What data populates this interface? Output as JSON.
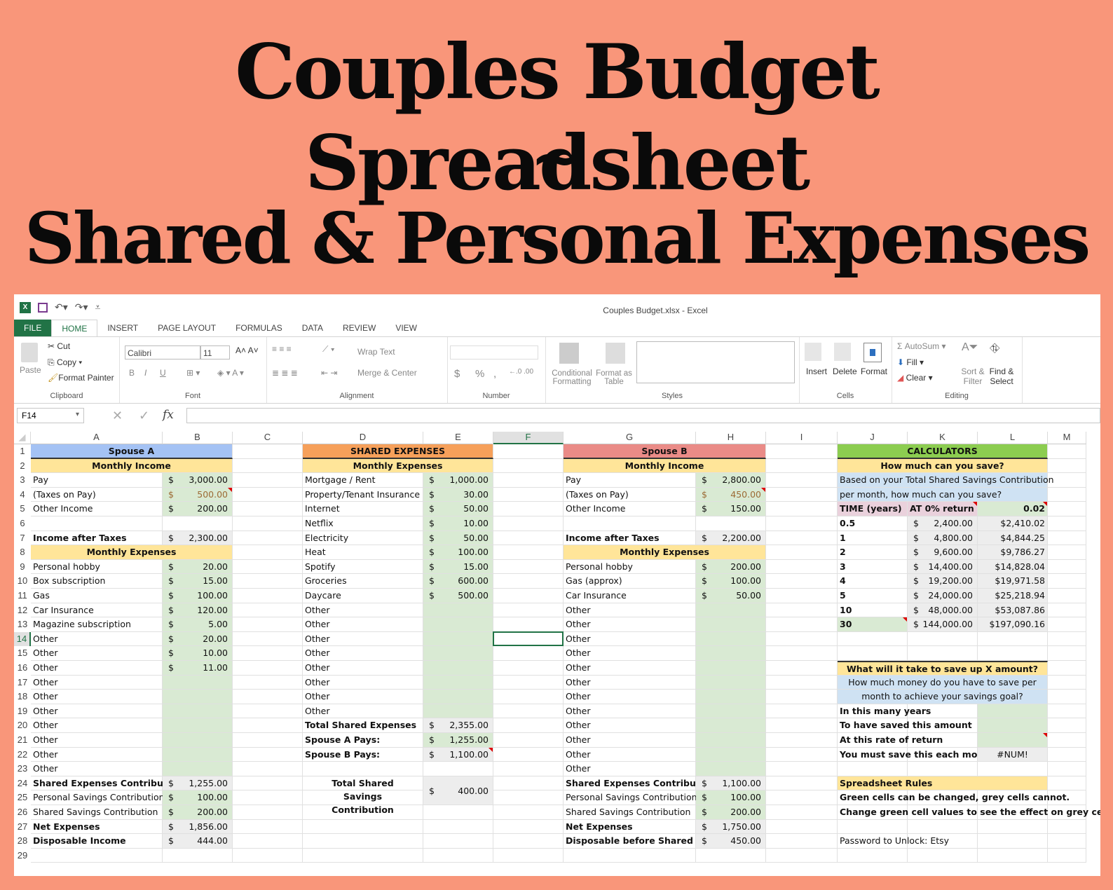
{
  "banner": {
    "line1": "Couples Budget Spreadsheet",
    "line2": "~",
    "line3": "Shared & Personal Expenses"
  },
  "window": {
    "title": "Couples Budget.xlsx - Excel"
  },
  "tabs": [
    "FILE",
    "HOME",
    "INSERT",
    "PAGE LAYOUT",
    "FORMULAS",
    "DATA",
    "REVIEW",
    "VIEW"
  ],
  "ribbon": {
    "clipboard": {
      "paste": "Paste",
      "cut": "Cut",
      "copy": "Copy",
      "format_painter": "Format Painter",
      "label": "Clipboard"
    },
    "font": {
      "name": "Calibri",
      "size": "11",
      "label": "Font",
      "bold": "B",
      "italic": "I",
      "underline": "U"
    },
    "alignment": {
      "wrap": "Wrap Text",
      "merge": "Merge & Center",
      "label": "Alignment"
    },
    "number": {
      "currency": "$",
      "percent": "%",
      "comma": ",",
      "label": "Number"
    },
    "styles": {
      "conditional": "Conditional Formatting",
      "format_table": "Format as Table",
      "label": "Styles"
    },
    "cells": {
      "insert": "Insert",
      "delete": "Delete",
      "format": "Format",
      "label": "Cells"
    },
    "editing": {
      "autosum": "AutoSum",
      "fill": "Fill",
      "clear": "Clear",
      "sort": "Sort & Filter",
      "find": "Find & Select",
      "label": "Editing"
    }
  },
  "formula_bar": {
    "name_box": "F14",
    "fx": "fx",
    "value": ""
  },
  "columns": [
    "A",
    "B",
    "C",
    "D",
    "E",
    "F",
    "G",
    "H",
    "I",
    "J",
    "K",
    "L",
    "M"
  ],
  "selected_cell": "F14",
  "spouseA": {
    "title": "Spouse A",
    "income_header": "Monthly Income",
    "income": [
      {
        "label": "Pay",
        "value": "3,000.00"
      },
      {
        "label": "(Taxes on Pay)",
        "value": "500.00"
      },
      {
        "label": "Other Income",
        "value": "200.00"
      }
    ],
    "after_tax": {
      "label": "Income after Taxes",
      "value": "2,300.00"
    },
    "expense_header": "Monthly Expenses",
    "expenses": [
      {
        "label": "Personal hobby",
        "value": "20.00"
      },
      {
        "label": "Box subscription",
        "value": "15.00"
      },
      {
        "label": "Gas",
        "value": "100.00"
      },
      {
        "label": "Car Insurance",
        "value": "120.00"
      },
      {
        "label": "Magazine subscription",
        "value": "5.00"
      },
      {
        "label": "Other",
        "value": "20.00"
      },
      {
        "label": "Other",
        "value": "10.00"
      },
      {
        "label": "Other",
        "value": "11.00"
      },
      {
        "label": "Other",
        "value": ""
      },
      {
        "label": "Other",
        "value": ""
      },
      {
        "label": "Other",
        "value": ""
      },
      {
        "label": "Other",
        "value": ""
      },
      {
        "label": "Other",
        "value": ""
      },
      {
        "label": "Other",
        "value": ""
      },
      {
        "label": "Other",
        "value": ""
      }
    ],
    "summary": [
      {
        "label": "Shared Expenses Contribution",
        "value": "1,255.00",
        "bold": true,
        "fill": "grey"
      },
      {
        "label": "Personal Savings Contribution",
        "value": "100.00",
        "bold": false,
        "fill": "green"
      },
      {
        "label": "Shared Savings Contribution",
        "value": "200.00",
        "bold": false,
        "fill": "green"
      },
      {
        "label": "Net Expenses",
        "value": "1,856.00",
        "bold": true,
        "fill": "grey"
      },
      {
        "label": "Disposable Income",
        "value": "444.00",
        "bold": true,
        "fill": "grey"
      }
    ]
  },
  "shared": {
    "title": "SHARED EXPENSES",
    "expense_header": "Monthly Expenses",
    "expenses": [
      {
        "label": "Mortgage / Rent",
        "value": "1,000.00"
      },
      {
        "label": "Property/Tenant Insurance",
        "value": "30.00"
      },
      {
        "label": "Internet",
        "value": "50.00"
      },
      {
        "label": "Netflix",
        "value": "10.00"
      },
      {
        "label": "Electricity",
        "value": "50.00"
      },
      {
        "label": "Heat",
        "value": "100.00"
      },
      {
        "label": "Spotify",
        "value": "15.00"
      },
      {
        "label": "Groceries",
        "value": "600.00"
      },
      {
        "label": "Daycare",
        "value": "500.00"
      },
      {
        "label": "Other",
        "value": ""
      },
      {
        "label": "Other",
        "value": ""
      },
      {
        "label": "Other",
        "value": ""
      },
      {
        "label": "Other",
        "value": ""
      },
      {
        "label": "Other",
        "value": ""
      },
      {
        "label": "Other",
        "value": ""
      },
      {
        "label": "Other",
        "value": ""
      },
      {
        "label": "Other",
        "value": ""
      }
    ],
    "totals": [
      {
        "label": "Total Shared Expenses",
        "value": "2,355.00",
        "fill": "grey"
      },
      {
        "label": "Spouse A Pays:",
        "value": "1,255.00",
        "fill": "green"
      },
      {
        "label": "Spouse B Pays:",
        "value": "1,100.00",
        "fill": "grey"
      }
    ],
    "savings": {
      "label": "Total Shared Savings Contribution",
      "value": "400.00"
    }
  },
  "spouseB": {
    "title": "Spouse B",
    "income_header": "Monthly Income",
    "income": [
      {
        "label": "Pay",
        "value": "2,800.00"
      },
      {
        "label": "(Taxes on Pay)",
        "value": "450.00"
      },
      {
        "label": "Other Income",
        "value": "150.00"
      }
    ],
    "after_tax": {
      "label": "Income after Taxes",
      "value": "2,200.00"
    },
    "expense_header": "Monthly Expenses",
    "expenses": [
      {
        "label": "Personal hobby",
        "value": "200.00"
      },
      {
        "label": "Gas (approx)",
        "value": "100.00"
      },
      {
        "label": "Car Insurance",
        "value": "50.00"
      },
      {
        "label": "Other",
        "value": ""
      },
      {
        "label": "Other",
        "value": ""
      },
      {
        "label": "Other",
        "value": ""
      },
      {
        "label": "Other",
        "value": ""
      },
      {
        "label": "Other",
        "value": ""
      },
      {
        "label": "Other",
        "value": ""
      },
      {
        "label": "Other",
        "value": ""
      },
      {
        "label": "Other",
        "value": ""
      },
      {
        "label": "Other",
        "value": ""
      },
      {
        "label": "Other",
        "value": ""
      },
      {
        "label": "Other",
        "value": ""
      },
      {
        "label": "Other",
        "value": ""
      }
    ],
    "summary": [
      {
        "label": "Shared Expenses Contribution",
        "value": "1,100.00",
        "bold": true,
        "fill": "grey"
      },
      {
        "label": "Personal Savings Contribution",
        "value": "100.00",
        "bold": false,
        "fill": "green"
      },
      {
        "label": "Shared Savings Contribution",
        "value": "200.00",
        "bold": false,
        "fill": "green"
      },
      {
        "label": "Net Expenses",
        "value": "1,750.00",
        "bold": true,
        "fill": "grey"
      },
      {
        "label": "Disposable before Shared",
        "value": "450.00",
        "bold": true,
        "fill": "grey"
      }
    ]
  },
  "calculators": {
    "title": "CALCULATORS",
    "save_header": "How much can you save?",
    "save_desc": [
      "Based on your Total Shared Savings Contribution",
      "per month, how much can you save?"
    ],
    "col_time": "TIME (years)",
    "col_zero": "AT 0% return",
    "rate": "0.02",
    "rows": [
      {
        "years": "0.5",
        "zero": "2,400.00",
        "rate": "$2,410.02"
      },
      {
        "years": "1",
        "zero": "4,800.00",
        "rate": "$4,844.25"
      },
      {
        "years": "2",
        "zero": "9,600.00",
        "rate": "$9,786.27"
      },
      {
        "years": "3",
        "zero": "14,400.00",
        "rate": "$14,828.04"
      },
      {
        "years": "4",
        "zero": "19,200.00",
        "rate": "$19,971.58"
      },
      {
        "years": "5",
        "zero": "24,000.00",
        "rate": "$25,218.94"
      },
      {
        "years": "10",
        "zero": "48,000.00",
        "rate": "$53,087.86"
      },
      {
        "years": "30",
        "zero": "144,000.00",
        "rate": "$197,090.16"
      }
    ],
    "goal_header": "What will it take to save up X amount?",
    "goal_desc": [
      "How much money do you have to save per",
      "month to achieve your savings goal?"
    ],
    "goal_rows": [
      {
        "label": "In this many years",
        "value": ""
      },
      {
        "label": "To have saved this amount",
        "value": ""
      },
      {
        "label": "At this rate of return",
        "value": ""
      },
      {
        "label": "You must save this each month",
        "value": "#NUM!"
      }
    ],
    "rules_header": "Spreadsheet Rules",
    "rules": [
      "Green cells can be changed, grey cells cannot.",
      "Change green cell values to see the effect on grey cells"
    ],
    "password": "Password to Unlock: Etsy"
  },
  "currency_symbol": "$"
}
